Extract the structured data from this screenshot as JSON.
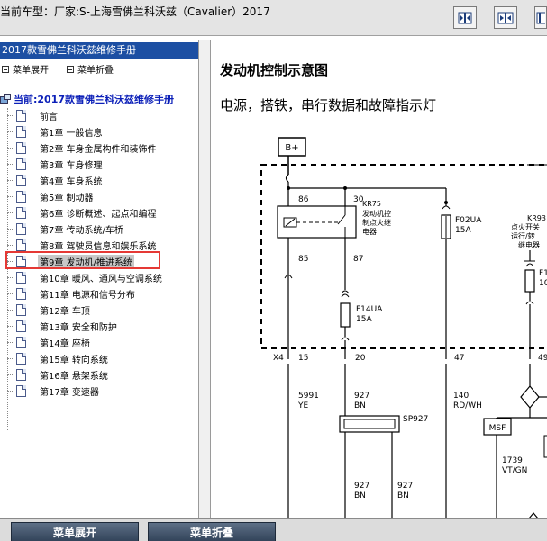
{
  "app": {
    "title": "当前车型：厂家:S-上海雪佛兰科沃兹（Cavalier）2017"
  },
  "toolbar": {
    "icons": [
      "collapse-left-icon",
      "split-view-icon",
      "collapse-right-icon"
    ]
  },
  "sidebar": {
    "header": "2017款雪佛兰科沃兹维修手册",
    "expand_label": "菜单展开",
    "collapse_label": "菜单折叠",
    "root_label": "当前:2017款雪佛兰科沃兹维修手册",
    "items": [
      {
        "label": "前言"
      },
      {
        "label": "第1章 一般信息"
      },
      {
        "label": "第2章 车身金属构件和装饰件"
      },
      {
        "label": "第3章 车身修理"
      },
      {
        "label": "第4章 车身系统"
      },
      {
        "label": "第5章 制动器"
      },
      {
        "label": "第6章 诊断概述、起点和编程"
      },
      {
        "label": "第7章 传动系统/车桥"
      },
      {
        "label": "第8章 驾驶员信息和娱乐系统"
      },
      {
        "label": "第9章 发动机/推进系统",
        "selected": true
      },
      {
        "label": "第10章 暖风、通风与空调系统"
      },
      {
        "label": "第11章 电源和信号分布"
      },
      {
        "label": "第12章 车顶"
      },
      {
        "label": "第13章 安全和防护"
      },
      {
        "label": "第14章 座椅"
      },
      {
        "label": "第15章 转向系统"
      },
      {
        "label": "第16章 悬架系统"
      },
      {
        "label": "第17章 变速器"
      }
    ]
  },
  "content": {
    "title": "发动机控制示意图",
    "subtitle": "电源，搭铁，串行数据和故障指示灯",
    "diagram": {
      "bplus": "B+",
      "kr75_label": "KR75",
      "kr75_desc": [
        "发动机控",
        "制点火继",
        "电器"
      ],
      "pin86": "86",
      "pin30": "30",
      "pin85": "85",
      "pin87": "87",
      "f02ua": "F02UA",
      "f02ua_amp": "15A",
      "f14ua": "F14UA",
      "f14ua_amp": "15A",
      "kr93_label": "KR93",
      "kr93_desc": [
        "点火开关",
        "运行/转",
        "继电器"
      ],
      "f_right": "F1",
      "f_right_amp": "10",
      "x4": "X4",
      "x4_15": "15",
      "x4_20": "20",
      "x4_47": "47",
      "x4_right": "49",
      "w1_num": "5991",
      "w1_color": "YE",
      "w2_num": "927",
      "w2_color": "BN",
      "w3_num": "140",
      "w3_color": "RD/WH",
      "sp927": "SP927",
      "msf": "MSF",
      "w4_num": "1739",
      "w4_color": "VT/GN",
      "w5_num": "927",
      "w5_color": "BN",
      "w6_num": "927",
      "w6_color": "BN"
    }
  },
  "bottom": {
    "expand_label": "菜单展开",
    "collapse_label": "菜单折叠"
  }
}
